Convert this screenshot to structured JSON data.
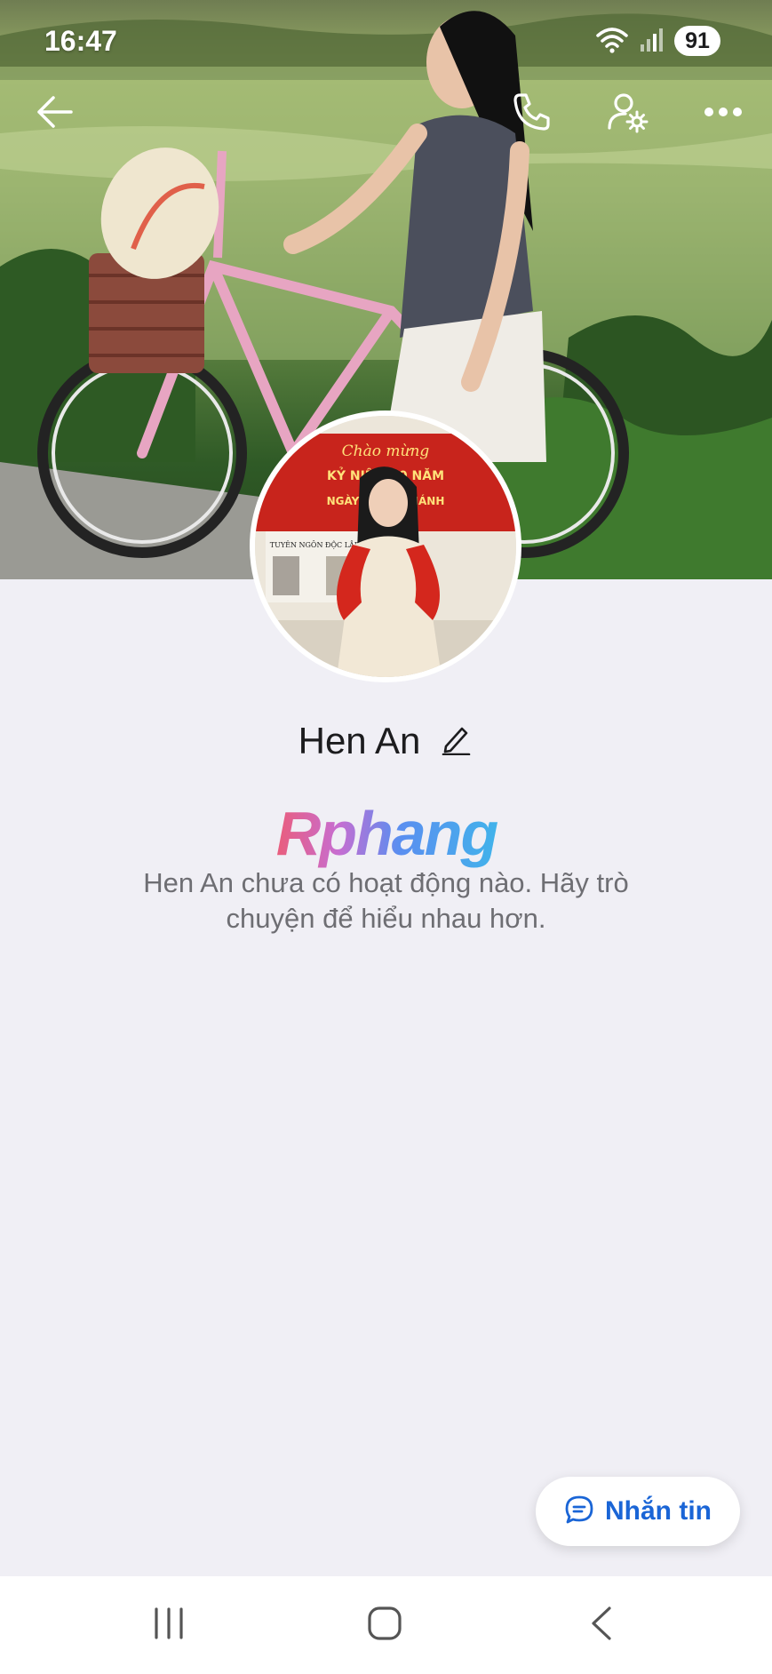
{
  "status_bar": {
    "time": "16:47",
    "battery": "91",
    "icons": [
      "wifi-icon",
      "cellular-signal-icon",
      "battery-icon"
    ]
  },
  "top_bar": {
    "icons": [
      "back-arrow-icon",
      "phone-call-icon",
      "user-settings-icon",
      "more-options-icon"
    ]
  },
  "profile": {
    "name": "Hen An",
    "edit_icon": "pencil-icon",
    "cover_photo": "woman with pink bicycle by a lake",
    "avatar_photo": "woman in ao dai with red flag scarf",
    "avatar_banner": {
      "line1": "Chào mừng",
      "line2": "KỶ NIỆM 80 NĂM",
      "line3": "NGÀY QUỐC KHÁNH",
      "sign": "TUYÊN NGÔN ĐỘC LẬP"
    }
  },
  "watermark": {
    "text": "Rphang"
  },
  "empty_state": {
    "message": "Hen An chưa có hoạt động nào. Hãy trò chuyện để hiểu nhau hơn."
  },
  "message_button": {
    "label": "Nhắn tin",
    "icon": "chat-bubble-icon"
  },
  "nav_bar": {
    "icons": [
      "recent-apps-icon",
      "home-icon",
      "back-icon"
    ]
  },
  "colors": {
    "background": "#f0eff5",
    "accent": "#1a65d6",
    "text_secondary": "#6e6e73"
  }
}
